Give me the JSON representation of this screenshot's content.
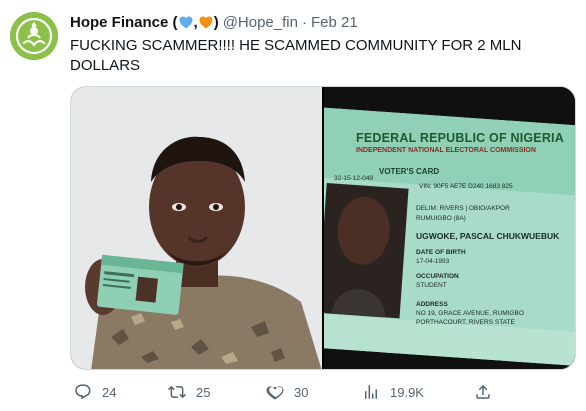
{
  "tweet": {
    "display_name": "Hope Finance (",
    "display_name_close": ")",
    "separator": ",",
    "handle": "@Hope_fin",
    "dot": "·",
    "date": "Feb 21",
    "text": "FUCKING SCAMMER!!!! HE SCAMMED COMMUNITY FOR 2 MLN\nDOLLARS"
  },
  "id_card": {
    "title": "FEDERAL REPUBLIC OF NIGERIA",
    "subtitle": "INDEPENDENT NATIONAL ELECTORAL COMMISSION",
    "voters_card": "VOTER'S CARD",
    "number": "32-15-12-049",
    "vin": "VIN: 90F5  AE7E  D240  1683  825",
    "delim": "DELIM: RIVERS  |  OBIO/AKPOR",
    "area": "RUMUIGBO (8A)",
    "name": "UGWOKE, PASCAL CHUKWUEBUK",
    "dob_label": "DATE OF BIRTH",
    "dob": "17-04-1993",
    "occ_label": "OCCUPATION",
    "occ": "STUDENT",
    "addr_label": "ADDRESS",
    "addr1": "NO 19, GRACE AVENUE, RUMIGBO",
    "addr2": "PORTHACOURT, RIVERS STATE"
  },
  "actions": {
    "replies": "24",
    "retweets": "25",
    "likes": "30",
    "views": "19.9K"
  },
  "colors": {
    "heart_blue": "#5dadec",
    "heart_orange": "#f4900c",
    "muted": "#536471",
    "avatar_green": "#8cc04a"
  },
  "icons": [
    "reply-icon",
    "retweet-icon",
    "like-icon",
    "views-icon",
    "share-icon"
  ]
}
